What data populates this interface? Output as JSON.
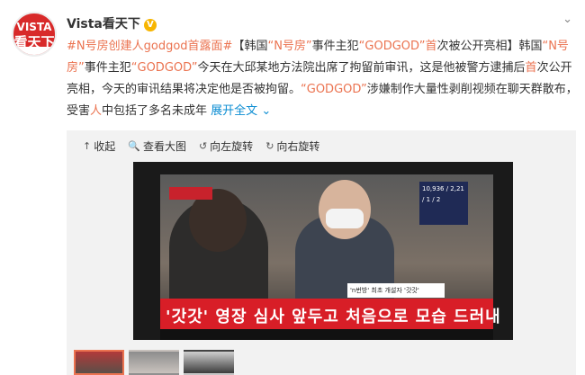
{
  "account": {
    "avatar_text_top": "VISTA",
    "avatar_text_bottom": "看天下",
    "name": "Vista看天下",
    "verified_icon": "verified-badge-icon"
  },
  "post": {
    "hashtag": "#N号房创建人godgod首露面#",
    "segments": [
      {
        "text": "【韩国",
        "color": "normal"
      },
      {
        "text": "“N号房”",
        "color": "link"
      },
      {
        "text": "事件主犯",
        "color": "normal"
      },
      {
        "text": "“GODGOD”",
        "color": "link"
      },
      {
        "text": "首",
        "color": "link"
      },
      {
        "text": "次被公开亮相】韩国",
        "color": "normal"
      },
      {
        "text": "“N号房”",
        "color": "link"
      },
      {
        "text": "事件主犯",
        "color": "normal"
      },
      {
        "text": "“GODGOD”",
        "color": "link"
      },
      {
        "text": "今天在大邱某地方法院出席了拘留前审讯，这是他被警方逮捕后",
        "color": "normal"
      },
      {
        "text": "首",
        "color": "link"
      },
      {
        "text": "次公开亮相，今天的审讯结果将决定他是否被拘留。",
        "color": "normal"
      },
      {
        "text": "“GODGOD”",
        "color": "link"
      },
      {
        "text": "涉嫌制作大量性剥削视频在聊天群散布，受害",
        "color": "normal"
      },
      {
        "text": "人",
        "color": "link"
      },
      {
        "text": "中包括了多名未成年 ",
        "color": "normal"
      }
    ],
    "expand_label": "展开全文",
    "expand_icon": "chevron-down-icon"
  },
  "media_toolbar": {
    "collapse": "收起",
    "view_large": "查看大图",
    "rotate_left": "向左旋转",
    "rotate_right": "向右旋转"
  },
  "photo": {
    "headline": "'갓갓' 영장 심사 앞두고 처음으로 모습 드러내",
    "side_caption": "'n번방' 최초 개설자 '갓갓'",
    "stats": "10,936 / 2,21 / 1 / 2"
  },
  "thumbnails": [
    {
      "label": "thumbnail-1",
      "active": true
    },
    {
      "label": "thumbnail-2",
      "active": false
    },
    {
      "label": "thumbnail-3",
      "active": false
    }
  ],
  "colors": {
    "link": "#eb7350",
    "accent_blue": "#0a8cd2",
    "headline_red": "#d81e27"
  }
}
